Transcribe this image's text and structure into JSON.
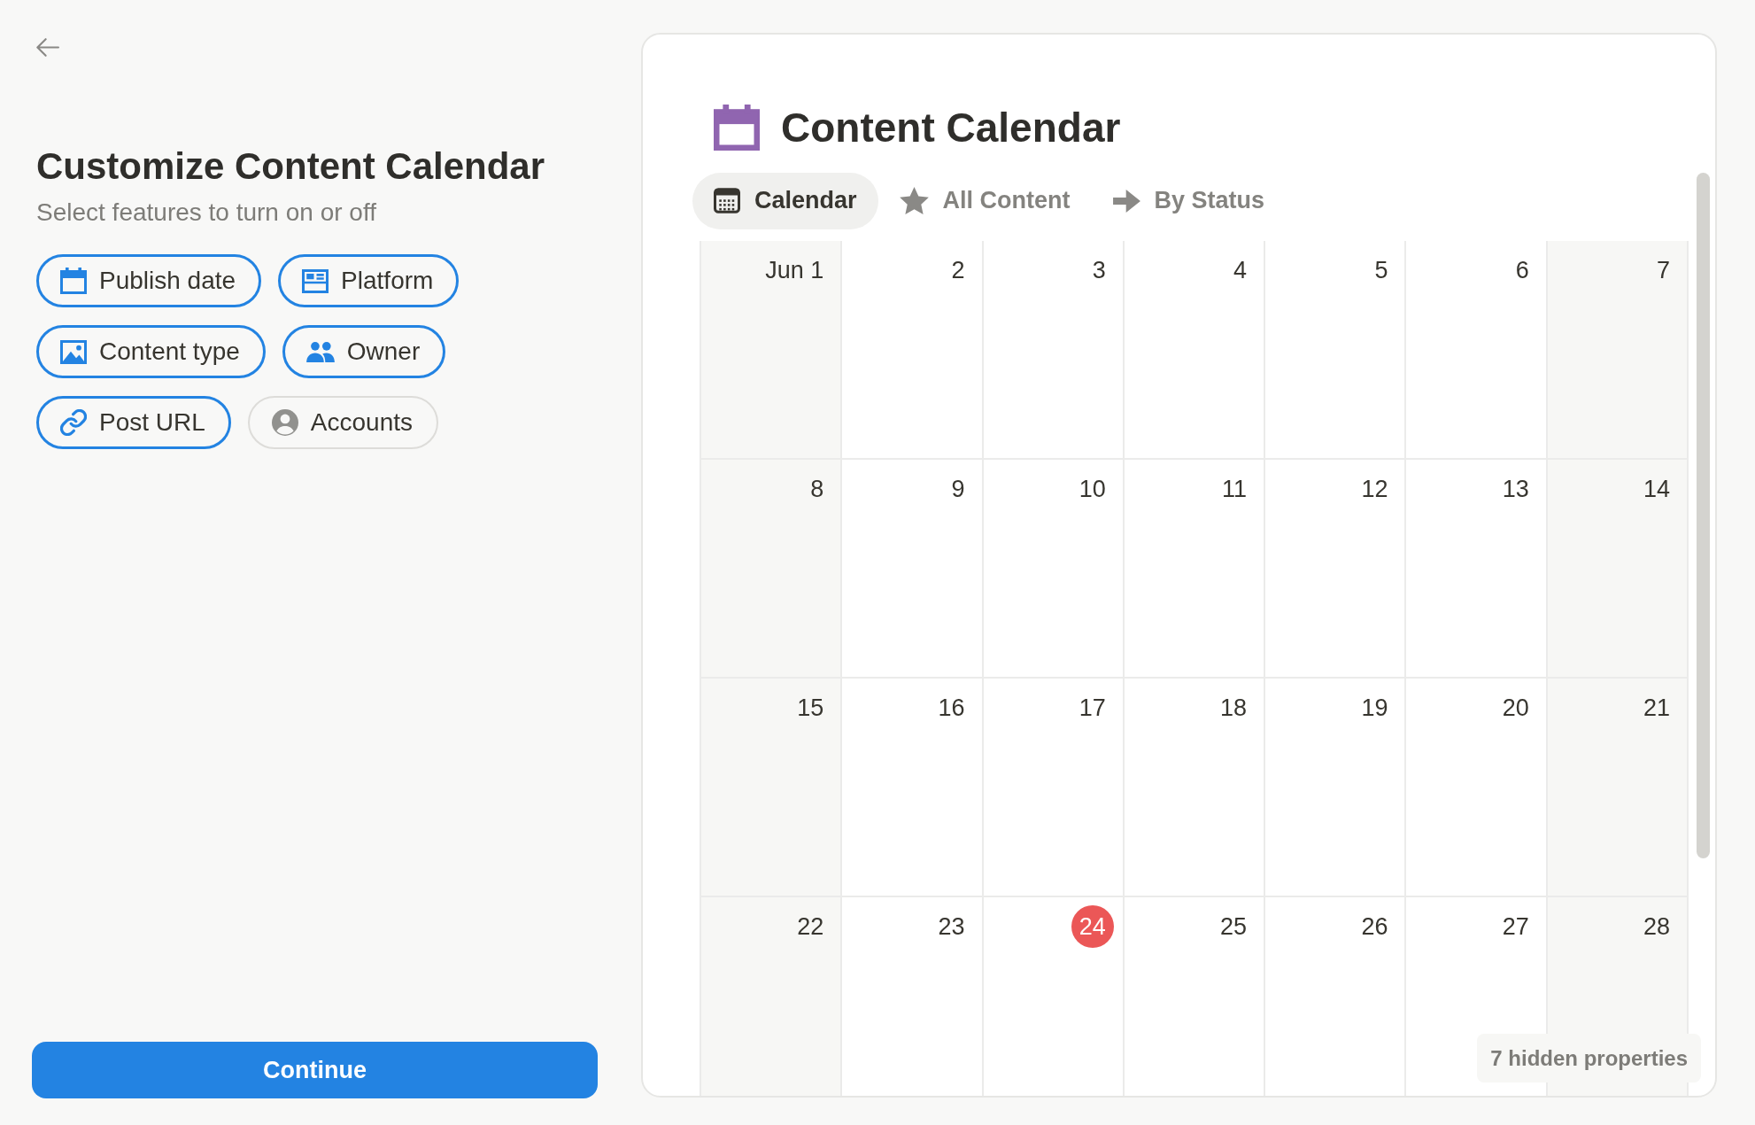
{
  "setup": {
    "title": "Customize Content Calendar",
    "subtitle": "Select features to turn on or off",
    "features": [
      {
        "label": "Publish date",
        "selected": true
      },
      {
        "label": "Platform",
        "selected": true
      },
      {
        "label": "Content type",
        "selected": true
      },
      {
        "label": "Owner",
        "selected": true
      },
      {
        "label": "Post URL",
        "selected": true
      },
      {
        "label": "Accounts",
        "selected": false
      }
    ],
    "continue_button": "Continue"
  },
  "preview": {
    "title": "Content Calendar",
    "tabs": [
      {
        "label": "Calendar",
        "selected": true
      },
      {
        "label": "All Content",
        "selected": false
      },
      {
        "label": "By Status",
        "selected": false
      }
    ],
    "calendar": {
      "weeks": [
        {
          "days": [
            {
              "label": "Jun 1",
              "today": false
            },
            {
              "label": "2",
              "today": false
            },
            {
              "label": "3",
              "today": false
            },
            {
              "label": "4",
              "today": false
            },
            {
              "label": "5",
              "today": false
            },
            {
              "label": "6",
              "today": false
            },
            {
              "label": "7",
              "today": false
            }
          ]
        },
        {
          "days": [
            {
              "label": "8",
              "today": false
            },
            {
              "label": "9",
              "today": false
            },
            {
              "label": "10",
              "today": false
            },
            {
              "label": "11",
              "today": false
            },
            {
              "label": "12",
              "today": false
            },
            {
              "label": "13",
              "today": false
            },
            {
              "label": "14",
              "today": false
            }
          ]
        },
        {
          "days": [
            {
              "label": "15",
              "today": false
            },
            {
              "label": "16",
              "today": false
            },
            {
              "label": "17",
              "today": false
            },
            {
              "label": "18",
              "today": false
            },
            {
              "label": "19",
              "today": false
            },
            {
              "label": "20",
              "today": false
            },
            {
              "label": "21",
              "today": false
            }
          ]
        },
        {
          "days": [
            {
              "label": "22",
              "today": false
            },
            {
              "label": "23",
              "today": false
            },
            {
              "label": "24",
              "today": true
            },
            {
              "label": "25",
              "today": false
            },
            {
              "label": "26",
              "today": false
            },
            {
              "label": "27",
              "today": false
            },
            {
              "label": "28",
              "today": false
            }
          ]
        }
      ]
    },
    "hidden_properties": "7 hidden properties"
  }
}
